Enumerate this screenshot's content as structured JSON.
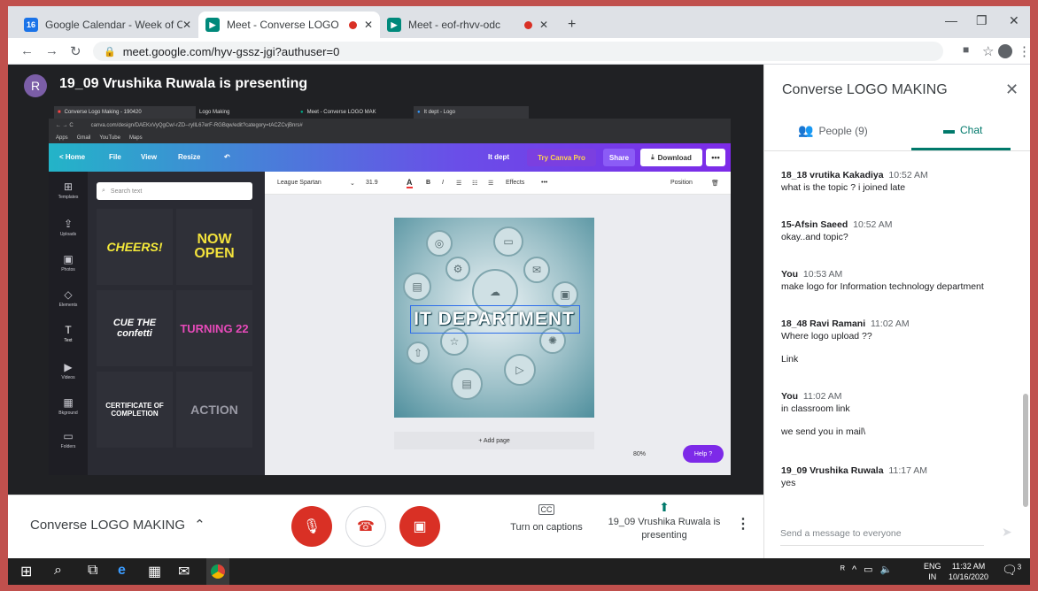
{
  "browser": {
    "tabs": [
      {
        "label": "Google Calendar - Week of Octo",
        "favicon": "calendar-icon",
        "favicon_text": "16",
        "favicon_color": "#1a73e8",
        "active": false,
        "recording": false
      },
      {
        "label": "Meet - Converse LOGO MAK",
        "favicon": "meet-icon",
        "active": true,
        "recording": true
      },
      {
        "label": "Meet - eof-rhvv-odc",
        "favicon": "meet-icon",
        "active": false,
        "recording": true
      }
    ],
    "new_tab": "+",
    "url": "meet.google.com/hyv-gssz-jgi?authuser=0"
  },
  "presentation": {
    "avatar_initial": "R",
    "avatar_color": "#7b5ea7",
    "title": "19_09 Vrushika Ruwala is presenting"
  },
  "shared_screen": {
    "tabs": [
      "Converse Logo Making - 190420",
      "Logo Making",
      "Meet - Converse LOGO MAK",
      "It dept - Logo"
    ],
    "url": "canva.com/design/DAEKxVyQgCw/-rZD--ryllL67erF-RGBqw/edit?category=tACZCvjBnrs#",
    "bookmarks": [
      "Apps",
      "Gmail",
      "YouTube",
      "Maps"
    ],
    "canva_bar": {
      "home": "< Home",
      "file": "File",
      "view": "View",
      "resize": "Resize",
      "design_name": "It dept",
      "try_pro": "Try Canva Pro",
      "share": "Share",
      "download": "Download"
    },
    "side_items": [
      "Templates",
      "Uploads",
      "Photos",
      "Elements",
      "Text",
      "Videos",
      "Bkground",
      "Folders"
    ],
    "search_placeholder": "Search text",
    "tiles": [
      {
        "text": "CHEERS!",
        "color": "#f5ea3a"
      },
      {
        "text": "NOW OPEN",
        "color": "#f3e23c"
      },
      {
        "text": "CUE THE confetti",
        "color": "#ffffff"
      },
      {
        "text": "TURNING 22",
        "color": "#e64ab9"
      },
      {
        "text": "CERTIFICATE OF COMPLETION",
        "color": "#ffffff"
      },
      {
        "text": "ACTION",
        "color": "#9a9aa5"
      }
    ],
    "toolbar": {
      "font": "League Spartan",
      "font_size": "31.9",
      "effects": "Effects",
      "position": "Position"
    },
    "design_text": "IT DEPARTMENT",
    "add_page": "+ Add page",
    "zoom": "80%",
    "help": "Help ?"
  },
  "bottom_bar": {
    "meeting_name": "Converse LOGO MAKING",
    "captions_label": "Turn on captions",
    "presenting_label": "19_09 Vrushika Ruwala is presenting"
  },
  "side_panel": {
    "title": "Converse LOGO MAKING",
    "people_tab": "People (9)",
    "chat_tab": "Chat",
    "messages": [
      {
        "sender": "18_18 vrutika Kakadiya",
        "time": "10:52 AM",
        "lines": [
          "what is the topic ? i joined late"
        ]
      },
      {
        "sender": "15-Afsin Saeed",
        "time": "10:52 AM",
        "lines": [
          "okay..and topic?"
        ]
      },
      {
        "sender": "You",
        "time": "10:53 AM",
        "lines": [
          "make logo for Information technology department"
        ]
      },
      {
        "sender": "18_48 Ravi Ramani",
        "time": "11:02 AM",
        "lines": [
          "Where logo upload ??",
          "Link"
        ]
      },
      {
        "sender": "You",
        "time": "11:02 AM",
        "lines": [
          "in classroom link",
          "we send you in mail\\"
        ]
      },
      {
        "sender": "19_09 Vrushika Ruwala",
        "time": "11:17 AM",
        "lines": [
          "yes"
        ]
      }
    ],
    "input_placeholder": "Send a message to everyone"
  },
  "taskbar": {
    "lang_top": "ENG",
    "lang_bottom": "IN",
    "time": "11:32 AM",
    "date": "10/16/2020",
    "notifications": "3"
  },
  "colors": {
    "end_call": "#d93025",
    "chat_accent": "#00796b",
    "canva_purple": "#7d2ae8"
  }
}
